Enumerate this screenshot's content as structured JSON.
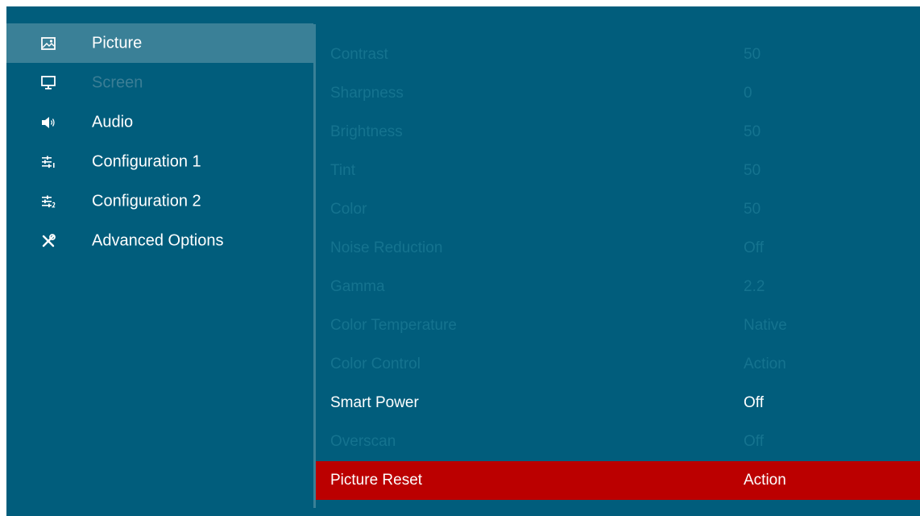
{
  "colors": {
    "background": "#015d7c",
    "sidebar_active": "#3a8097",
    "disabled_text": "#15738f",
    "selected_row": "#bb0000"
  },
  "sidebar": {
    "items": [
      {
        "label": "Picture",
        "icon": "picture-icon",
        "state": "active"
      },
      {
        "label": "Screen",
        "icon": "monitor-icon",
        "state": "disabled"
      },
      {
        "label": "Audio",
        "icon": "speaker-icon",
        "state": "normal"
      },
      {
        "label": "Configuration 1",
        "icon": "sliders-1-icon",
        "state": "normal"
      },
      {
        "label": "Configuration 2",
        "icon": "sliders-2-icon",
        "state": "normal"
      },
      {
        "label": "Advanced Options",
        "icon": "tools-icon",
        "state": "normal"
      }
    ]
  },
  "settings": {
    "rows": [
      {
        "name": "Contrast",
        "value": "50",
        "state": "disabled"
      },
      {
        "name": "Sharpness",
        "value": "0",
        "state": "disabled"
      },
      {
        "name": "Brightness",
        "value": "50",
        "state": "disabled"
      },
      {
        "name": "Tint",
        "value": "50",
        "state": "disabled"
      },
      {
        "name": "Color",
        "value": "50",
        "state": "disabled"
      },
      {
        "name": "Noise Reduction",
        "value": "Off",
        "state": "disabled"
      },
      {
        "name": "Gamma",
        "value": "2.2",
        "state": "disabled"
      },
      {
        "name": "Color Temperature",
        "value": "Native",
        "state": "disabled"
      },
      {
        "name": "Color Control",
        "value": "Action",
        "state": "disabled"
      },
      {
        "name": "Smart Power",
        "value": "Off",
        "state": "enabled"
      },
      {
        "name": "Overscan",
        "value": "Off",
        "state": "disabled"
      },
      {
        "name": "Picture Reset",
        "value": "Action",
        "state": "selected"
      }
    ]
  }
}
